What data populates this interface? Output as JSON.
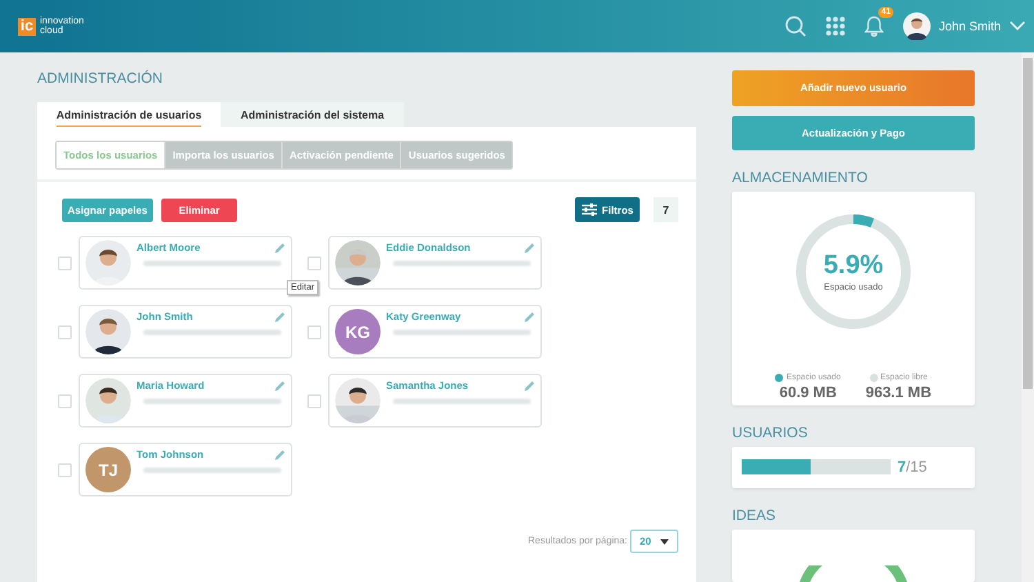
{
  "header": {
    "logo": {
      "mark": "ic",
      "line1": "innovation",
      "line2": "cloud"
    },
    "notifications": "41",
    "user": "John Smith"
  },
  "page_title": "ADMINISTRACIÓN",
  "tabs": [
    {
      "label": "Administración de usuarios",
      "selected": true
    },
    {
      "label": "Administración del sistema",
      "selected": false
    }
  ],
  "subtabs": [
    {
      "label": "Todos los usuarios",
      "selected": true
    },
    {
      "label": "Importa los usuarios",
      "selected": false
    },
    {
      "label": "Activación pendiente",
      "selected": false
    },
    {
      "label": "Usuarios sugeridos",
      "selected": false
    }
  ],
  "actions": {
    "assign": "Asignar papeles",
    "delete": "Eliminar",
    "filters": "Filtros",
    "count": "7"
  },
  "users": [
    {
      "name": "Albert Moore",
      "checked": false
    },
    {
      "name": "Eddie Donaldson",
      "checked": false
    },
    {
      "name": "John Smith",
      "checked": false
    },
    {
      "name": "Katy Greenway",
      "kind": "initials",
      "initials": "KG",
      "color": "#a77dbf",
      "checked": false
    },
    {
      "name": "Maria Howard",
      "checked": false
    },
    {
      "name": "Samantha Jones",
      "checked": false
    },
    {
      "name": "Tom Johnson",
      "kind": "initials",
      "initials": "TJ",
      "color": "#c0966a",
      "checked": false
    }
  ],
  "tooltip": "Editar",
  "pagination": {
    "label": "Resultados por página:",
    "value": "20"
  },
  "sidebar": {
    "add_user": "Añadir nuevo usuario",
    "billing": "Actualización y Pago",
    "storage": {
      "title": "ALMACENAMIENTO",
      "percent": "5.9%",
      "caption": "Espacio usado",
      "level": 0.059,
      "legend": [
        {
          "label": "Espacio usado",
          "value": "60.9 MB",
          "color": "#3aacb4"
        },
        {
          "label": "Espacio libre",
          "value": "963.1 MB",
          "color": "#d9e1e0"
        }
      ]
    },
    "users": {
      "title": "USUARIOS",
      "used": "7",
      "total": "/15",
      "level": 0.467
    },
    "ideas": {
      "title": "IDEAS"
    }
  }
}
